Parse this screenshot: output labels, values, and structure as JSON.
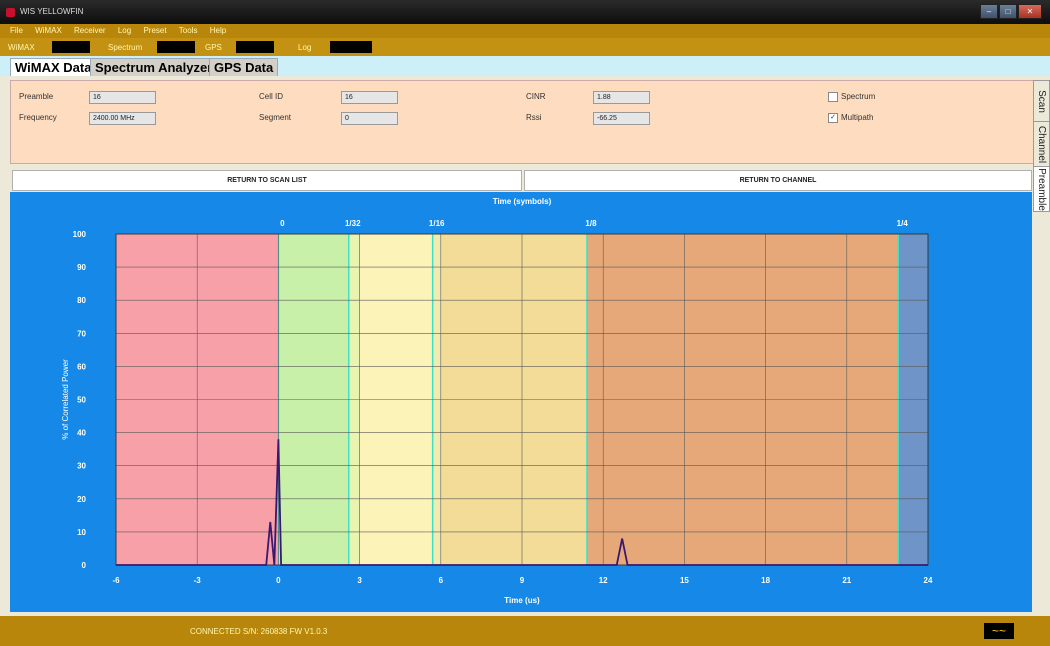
{
  "window": {
    "title": "WIS YELLOWFIN"
  },
  "menu": [
    "File",
    "WiMAX",
    "Receiver",
    "Log",
    "Preset",
    "Tools",
    "Help"
  ],
  "status_strip": {
    "wimax_label": "WiMAX",
    "spectrum_label": "Spectrum",
    "gps_label": "GPS",
    "log_label": "Log"
  },
  "tabs": [
    "WiMAX Data",
    "Spectrum Analyzer",
    "GPS Data"
  ],
  "fields": {
    "preamble": {
      "label": "Preamble",
      "value": "16"
    },
    "frequency": {
      "label": "Frequency",
      "value": "2400.00 MHz"
    },
    "cell_id": {
      "label": "Cell ID",
      "value": "16"
    },
    "segment": {
      "label": "Segment",
      "value": "0"
    },
    "cinr": {
      "label": "CINR",
      "value": "1.88"
    },
    "rssi": {
      "label": "Rssi",
      "value": "-66.25"
    }
  },
  "checkboxes": {
    "spectrum": {
      "label": "Spectrum",
      "checked": false
    },
    "multipath": {
      "label": "Multipath",
      "checked": true
    }
  },
  "side_tabs": [
    "Scan",
    "Channel",
    "Preamble"
  ],
  "buttons": {
    "return_scan": "RETURN TO SCAN LIST",
    "return_channel": "RETURN TO CHANNEL"
  },
  "chart_data": {
    "type": "line",
    "title": "Time (symbols)",
    "xlabel": "Time (us)",
    "ylabel": "% of Correlated Power",
    "xlim": [
      -6,
      24
    ],
    "ylim": [
      0,
      100
    ],
    "x_ticks": [
      -6,
      -3,
      0,
      3,
      6,
      9,
      12,
      15,
      18,
      21,
      24
    ],
    "y_ticks": [
      0,
      10,
      20,
      30,
      40,
      50,
      60,
      70,
      80,
      90,
      100
    ],
    "top_ticks": [
      {
        "label": "0",
        "x": 0
      },
      {
        "label": "1/32",
        "x": 2.6
      },
      {
        "label": "1/16",
        "x": 5.7
      },
      {
        "label": "1/8",
        "x": 11.4
      },
      {
        "label": "1/4",
        "x": 22.9
      }
    ],
    "bands": [
      {
        "from": -6,
        "to": 0,
        "color": "#f8a0a8"
      },
      {
        "from": 0,
        "to": 2.6,
        "color": "#c8f0a8"
      },
      {
        "from": 2.6,
        "to": 3.0,
        "color": "#e8f4b0"
      },
      {
        "from": 3.0,
        "to": 5.7,
        "color": "#fbf3b8"
      },
      {
        "from": 5.7,
        "to": 6.0,
        "color": "#f2ebb0"
      },
      {
        "from": 6.0,
        "to": 11.4,
        "color": "#f2dc98"
      },
      {
        "from": 11.4,
        "to": 22.9,
        "color": "#e6a878"
      },
      {
        "from": 22.9,
        "to": 24,
        "color": "#6e94c8"
      }
    ],
    "series": [
      {
        "color": "#3a1870",
        "x": [
          -6,
          -0.45,
          -0.3,
          -0.15,
          0,
          0.1,
          0.25,
          12.5,
          12.7,
          12.9,
          24
        ],
        "y": [
          0,
          0,
          13,
          0,
          38,
          0,
          0,
          0,
          8,
          0,
          0
        ]
      }
    ]
  },
  "footer": {
    "connection": "CONNECTED S/N: 260838   FW V1.0.3",
    "logo": "~~"
  }
}
